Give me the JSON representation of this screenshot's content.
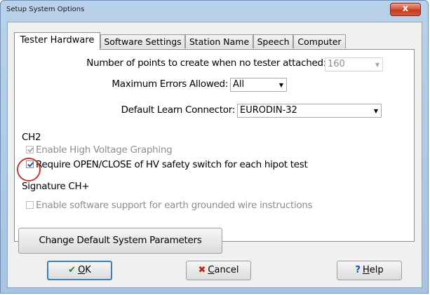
{
  "window": {
    "title": "Setup System Options",
    "close_glyph": "x"
  },
  "tabs": [
    {
      "label": "Tester Hardware",
      "active": true
    },
    {
      "label": "Software Settings",
      "active": false
    },
    {
      "label": "Station Name",
      "active": false
    },
    {
      "label": "Speech",
      "active": false
    },
    {
      "label": "Computer",
      "active": false
    }
  ],
  "fields": {
    "points_label": "Number of points to create when no tester attached:",
    "points_value": "160",
    "max_errors_label": "Maximum Errors Allowed:",
    "max_errors_value": "All",
    "learn_connector_label": "Default Learn Connector:",
    "learn_connector_value": "EURODIN-32"
  },
  "sections": {
    "ch2": "CH2",
    "signature": "Signature CH+"
  },
  "checkboxes": {
    "hv_graphing": {
      "label": "Enable High Voltage Graphing",
      "checked": true,
      "enabled": false
    },
    "require_open_close": {
      "label": "Require OPEN/CLOSE of HV safety switch for each hipot test",
      "checked": true,
      "enabled": true
    },
    "earth_grounded": {
      "label": "Enable software support for earth grounded wire instructions",
      "checked": false,
      "enabled": false
    }
  },
  "buttons": {
    "change_defaults": "Change Default System Parameters",
    "ok_icon": "✔",
    "ok_prefix": "",
    "ok_hotkey": "O",
    "ok_rest": "K",
    "cancel_icon": "✖",
    "cancel_hotkey": "C",
    "cancel_rest": "ancel",
    "help_icon": "?",
    "help_hotkey": "H",
    "help_rest": "elp"
  },
  "colors": {
    "title_bar": "#b9d1ea",
    "close_button": "#c5391f",
    "annotation_circle": "#c0392b",
    "ok_icon": "#1a8a1a",
    "cancel_icon": "#c0261c",
    "help_icon": "#1c4fa3"
  }
}
